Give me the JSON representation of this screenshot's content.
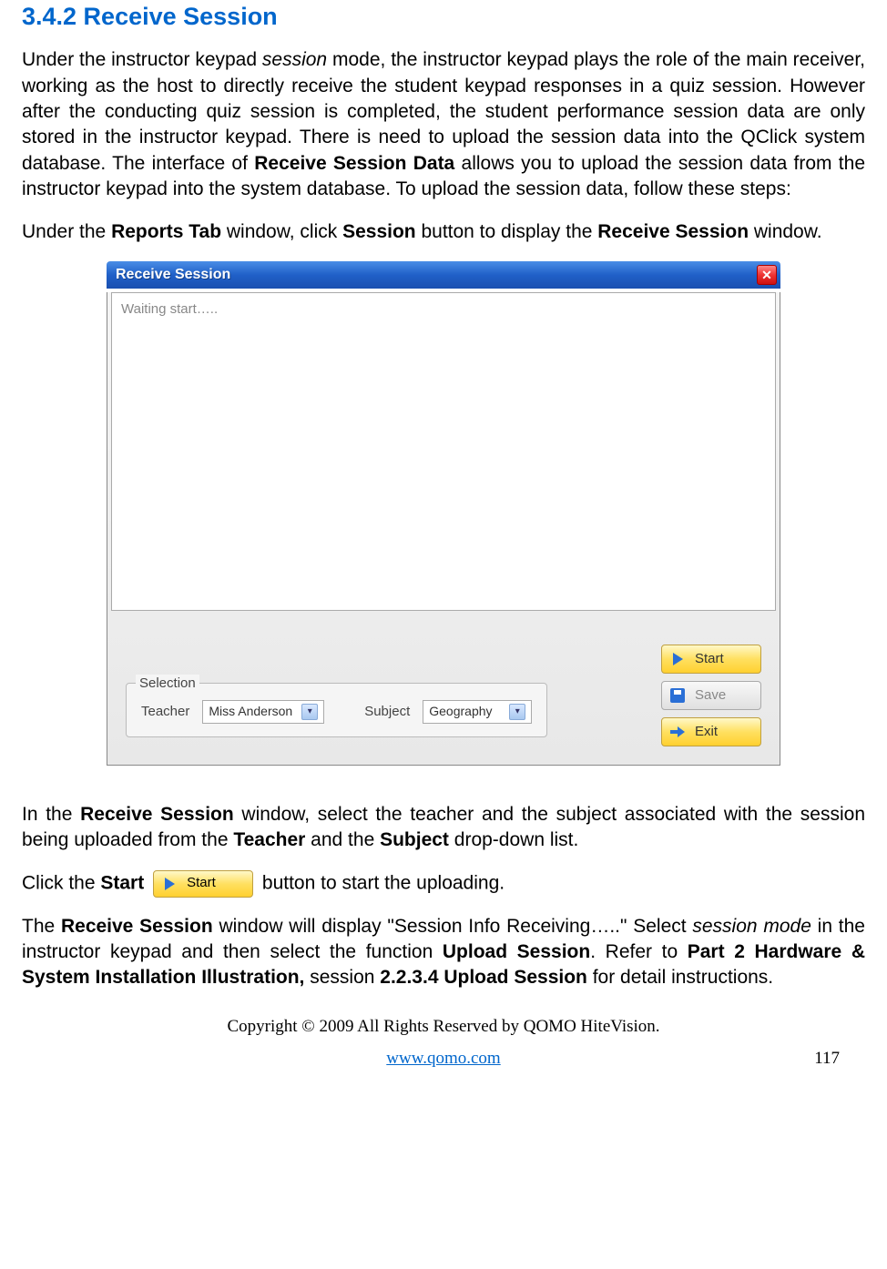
{
  "heading": "3.4.2 Receive Session",
  "para1_a": "Under the instructor keypad ",
  "para1_session": "session",
  "para1_b": " mode, the instructor keypad plays the role of the main receiver, working as the host to directly receive the student keypad responses in a quiz session. However after the conducting quiz session is completed, the student performance session data are only stored in the instructor keypad. There is need to upload the session data into the QClick system database. The interface of ",
  "para1_bold1": "Receive Session Data",
  "para1_c": " allows you to upload the session data from the instructor keypad into the system database. To upload the session data, follow these steps:",
  "para2_a": "Under the ",
  "para2_bold1": "Reports Tab",
  "para2_b": " window, click ",
  "para2_bold2": "Session",
  "para2_c": " button to display the ",
  "para2_bold3": "Receive Session",
  "para2_d": " window.",
  "dialog": {
    "title": "Receive Session",
    "waiting": "Waiting start…..",
    "selection_legend": "Selection",
    "teacher_label": "Teacher",
    "teacher_value": "Miss Anderson",
    "subject_label": "Subject",
    "subject_value": "Geography",
    "start": "Start",
    "save": "Save",
    "exit": "Exit"
  },
  "para3_a": "In the ",
  "para3_bold1": "Receive Session",
  "para3_b": " window, select the teacher and the subject associated with the session being uploaded from the ",
  "para3_bold2": "Teacher",
  "para3_c": " and the ",
  "para3_bold3": "Subject",
  "para3_d": " drop-down list.",
  "para4_a": "Click the ",
  "para4_bold1": "Start",
  "para4_b": " button to start the uploading.",
  "para5_a": "The ",
  "para5_bold1": "Receive Session",
  "para5_b": " window will display \"Session Info Receiving…..\"  Select ",
  "para5_ital1": "session mode",
  "para5_c": " in the instructor keypad and then select the function ",
  "para5_bold2": "Upload Session",
  "para5_d": ". Refer to ",
  "para5_bold3": "Part 2 Hardware & System Installation Illustration,",
  "para5_e": " session ",
  "para5_bold4": "2.2.3.4 Upload Session",
  "para5_f": " for detail instructions.",
  "copyright": "Copyright © 2009 All Rights Reserved by QOMO HiteVision.",
  "url": "www.qomo.com",
  "page": "117"
}
